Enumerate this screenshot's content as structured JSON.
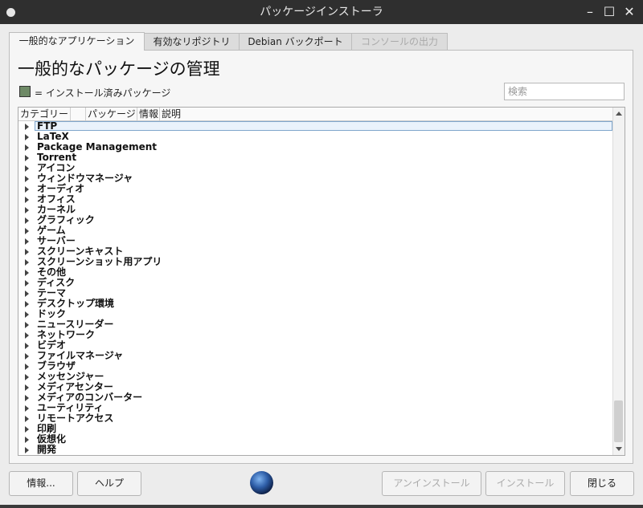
{
  "window": {
    "title": "パッケージインストーラ",
    "minimize_glyph": "–",
    "maximize_glyph": "☐",
    "close_glyph": "✕"
  },
  "tabs": [
    {
      "label": "一般的なアプリケーション",
      "state": "active"
    },
    {
      "label": "有効なリポジトリ",
      "state": "normal"
    },
    {
      "label": "Debian バックポート",
      "state": "normal"
    },
    {
      "label": "コンソールの出力",
      "state": "disabled"
    }
  ],
  "main": {
    "heading": "一般的なパッケージの管理",
    "legend_text": "= インストール済みパッケージ",
    "legend_color": "#6e8a66",
    "search_placeholder": "検索"
  },
  "tree": {
    "columns": [
      "カテゴリー",
      "",
      "パッケージ",
      "情報",
      "説明"
    ],
    "categories": [
      "FTP",
      "LaTeX",
      "Package Management",
      "Torrent",
      "アイコン",
      "ウィンドウマネージャ",
      "オーディオ",
      "オフィス",
      "カーネル",
      "グラフィック",
      "ゲーム",
      "サーバー",
      "スクリーンキャスト",
      "スクリーンショット用アプリ",
      "その他",
      "ディスク",
      "テーマ",
      "デスクトップ環境",
      "ドック",
      "ニュースリーダー",
      "ネットワーク",
      "ビデオ",
      "ファイルマネージャ",
      "ブラウザ",
      "メッセンジャー",
      "メディアセンター",
      "メディアのコンバーター",
      "ユーティリティ",
      "リモートアクセス",
      "印刷",
      "仮想化",
      "開発"
    ],
    "selected_index": 0
  },
  "footer": {
    "info_label": "情報...",
    "help_label": "ヘルプ",
    "uninstall_label": "アンインストール",
    "install_label": "インストール",
    "close_label": "閉じる"
  }
}
